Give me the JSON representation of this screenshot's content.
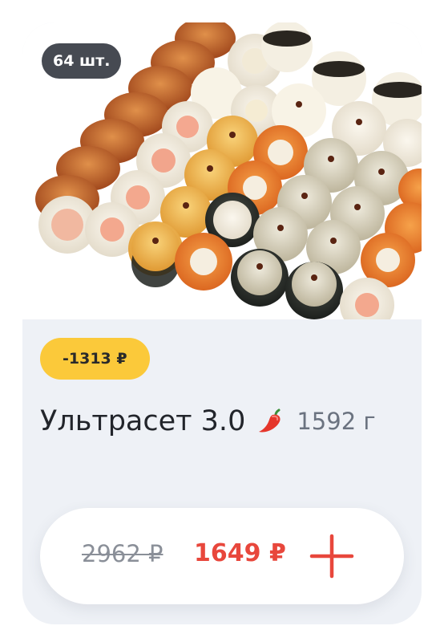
{
  "product": {
    "count_badge": "64 шт.",
    "discount_badge": "-1313 ₽",
    "title": "Ультрасет 3.0",
    "weight": "1592 г",
    "spicy_icon": "chili-pepper-icon",
    "old_price": "2962 ₽",
    "new_price": "1649 ₽",
    "add_icon": "plus-icon"
  },
  "colors": {
    "card_background": "#eef1f6",
    "count_badge": "#464a52",
    "discount_badge": "#fbc93a",
    "accent_red": "#e8473c"
  }
}
